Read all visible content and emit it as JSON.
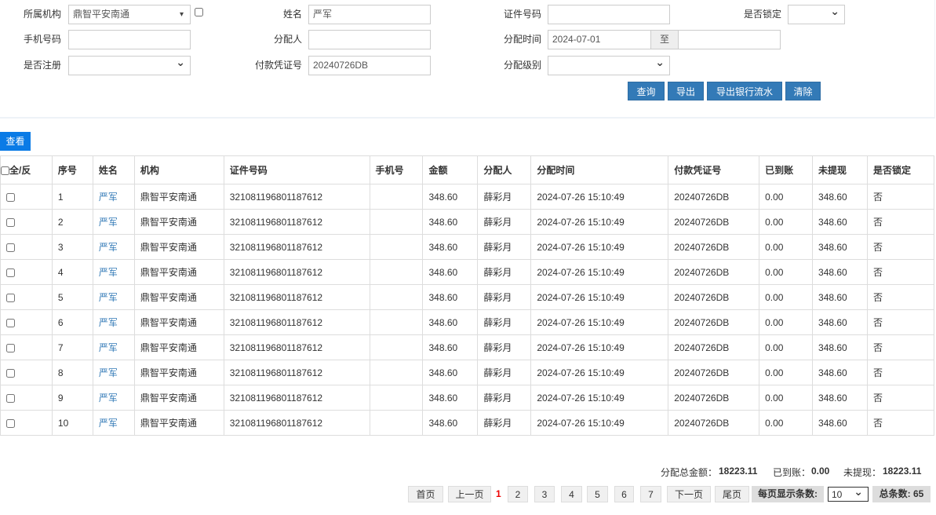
{
  "filters": {
    "org_label": "所属机构",
    "org_value": "鼎智平安南通",
    "name_label": "姓名",
    "name_value": "严军",
    "id_label": "证件号码",
    "id_value": "",
    "locked_label": "是否锁定",
    "locked_value": "",
    "phone_label": "手机号码",
    "phone_value": "",
    "assigner_label": "分配人",
    "assigner_value": "",
    "time_label": "分配时间",
    "time_from": "2024-07-01",
    "time_to_sep": "至",
    "time_to": "",
    "registered_label": "是否注册",
    "registered_value": "",
    "voucher_label": "付款凭证号",
    "voucher_value": "20240726DB",
    "level_label": "分配级别",
    "level_value": ""
  },
  "buttons": {
    "query": "查询",
    "export": "导出",
    "export_bank": "导出银行流水",
    "clear": "清除",
    "view": "查看"
  },
  "table": {
    "headers": [
      "全/反",
      "序号",
      "姓名",
      "机构",
      "证件号码",
      "手机号",
      "金额",
      "分配人",
      "分配时间",
      "付款凭证号",
      "已到账",
      "未提现",
      "是否锁定"
    ],
    "rows": [
      [
        "1",
        "严军",
        "鼎智平安南通",
        "321081196801187612",
        "",
        "348.60",
        "薛彩月",
        "2024-07-26 15:10:49",
        "20240726DB",
        "0.00",
        "348.60",
        "否"
      ],
      [
        "2",
        "严军",
        "鼎智平安南通",
        "321081196801187612",
        "",
        "348.60",
        "薛彩月",
        "2024-07-26 15:10:49",
        "20240726DB",
        "0.00",
        "348.60",
        "否"
      ],
      [
        "3",
        "严军",
        "鼎智平安南通",
        "321081196801187612",
        "",
        "348.60",
        "薛彩月",
        "2024-07-26 15:10:49",
        "20240726DB",
        "0.00",
        "348.60",
        "否"
      ],
      [
        "4",
        "严军",
        "鼎智平安南通",
        "321081196801187612",
        "",
        "348.60",
        "薛彩月",
        "2024-07-26 15:10:49",
        "20240726DB",
        "0.00",
        "348.60",
        "否"
      ],
      [
        "5",
        "严军",
        "鼎智平安南通",
        "321081196801187612",
        "",
        "348.60",
        "薛彩月",
        "2024-07-26 15:10:49",
        "20240726DB",
        "0.00",
        "348.60",
        "否"
      ],
      [
        "6",
        "严军",
        "鼎智平安南通",
        "321081196801187612",
        "",
        "348.60",
        "薛彩月",
        "2024-07-26 15:10:49",
        "20240726DB",
        "0.00",
        "348.60",
        "否"
      ],
      [
        "7",
        "严军",
        "鼎智平安南通",
        "321081196801187612",
        "",
        "348.60",
        "薛彩月",
        "2024-07-26 15:10:49",
        "20240726DB",
        "0.00",
        "348.60",
        "否"
      ],
      [
        "8",
        "严军",
        "鼎智平安南通",
        "321081196801187612",
        "",
        "348.60",
        "薛彩月",
        "2024-07-26 15:10:49",
        "20240726DB",
        "0.00",
        "348.60",
        "否"
      ],
      [
        "9",
        "严军",
        "鼎智平安南通",
        "321081196801187612",
        "",
        "348.60",
        "薛彩月",
        "2024-07-26 15:10:49",
        "20240726DB",
        "0.00",
        "348.60",
        "否"
      ],
      [
        "10",
        "严军",
        "鼎智平安南通",
        "321081196801187612",
        "",
        "348.60",
        "薛彩月",
        "2024-07-26 15:10:49",
        "20240726DB",
        "0.00",
        "348.60",
        "否"
      ]
    ]
  },
  "summary": {
    "total_label": "分配总金额：",
    "total": "18223.11",
    "arrived_label": "已到账：",
    "arrived": "0.00",
    "unwithdrawn_label": "未提现：",
    "unwithdrawn": "18223.11"
  },
  "pagination": {
    "first": "首页",
    "prev": "上一页",
    "current": "1",
    "pages": [
      "2",
      "3",
      "4",
      "5",
      "6",
      "7"
    ],
    "next": "下一页",
    "last": "尾页",
    "per_page_label": "每页显示条数:",
    "per_page": "10",
    "total": "总条数: 65"
  }
}
